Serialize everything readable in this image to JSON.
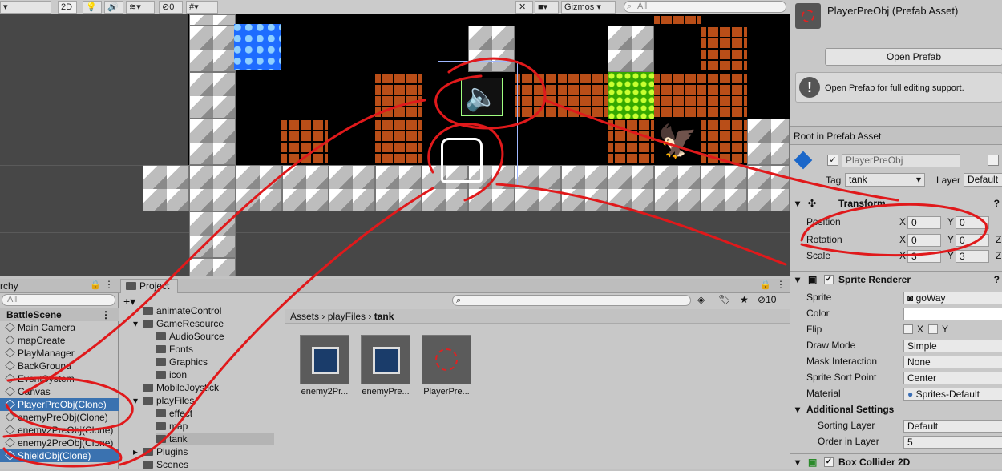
{
  "toolbar": {
    "mode_2d": "2D",
    "hidden_count": "0",
    "gizmos_label": "Gizmos",
    "search_placeholder": "All"
  },
  "hierarchy": {
    "tab": "rchy",
    "search_placeholder": "All",
    "scene": "BattleScene",
    "items": [
      {
        "label": "Main Camera",
        "selected": false
      },
      {
        "label": "mapCreate",
        "selected": false
      },
      {
        "label": "PlayManager",
        "selected": false
      },
      {
        "label": "BackGround",
        "selected": false
      },
      {
        "label": "EventSystem",
        "selected": false
      },
      {
        "label": "Canvas",
        "selected": false
      },
      {
        "label": "PlayerPreObj(Clone)",
        "selected": true
      },
      {
        "label": "enemyPreObj(Clone)",
        "selected": false
      },
      {
        "label": "enemy2PreObj(Clone)",
        "selected": false
      },
      {
        "label": "enemy2PreObj(Clone)",
        "selected": false
      },
      {
        "label": "ShieldObj(Clone)",
        "selected": true
      }
    ]
  },
  "project": {
    "tab": "Project",
    "hidden_count": "10",
    "tree": [
      "animateControl",
      "GameResource",
      "AudioSource",
      "Fonts",
      "Graphics",
      "icon",
      "MobileJoystick",
      "playFiles",
      "effect",
      "map",
      "tank",
      "Plugins",
      "Scenes"
    ],
    "breadcrumb": [
      "Assets",
      "playFiles",
      "tank"
    ],
    "assets": [
      "enemy2Pr...",
      "enemyPre...",
      "PlayerPre..."
    ]
  },
  "inspector": {
    "title": "PlayerPreObj (Prefab Asset)",
    "open_prefab": "Open Prefab",
    "info": "Open Prefab for full editing support.",
    "root_label": "Root in Prefab Asset",
    "object_name": "PlayerPreObj",
    "tag_label": "Tag",
    "tag_value": "tank",
    "layer_label": "Layer",
    "layer_value": "Default",
    "transform": {
      "header": "Transform",
      "position_label": "Position",
      "rotation_label": "Rotation",
      "scale_label": "Scale",
      "pos_x": "0",
      "pos_y": "0",
      "rot_x": "0",
      "rot_y": "0",
      "scale_x": "3",
      "scale_y": "3"
    },
    "sprite_renderer": {
      "header": "Sprite Renderer",
      "sprite_label": "Sprite",
      "sprite_value": "goWay",
      "color_label": "Color",
      "flip_label": "Flip",
      "flip_x": "X",
      "flip_y": "Y",
      "draw_mode_label": "Draw Mode",
      "draw_mode_value": "Simple",
      "mask_label": "Mask Interaction",
      "mask_value": "None",
      "sort_point_label": "Sprite Sort Point",
      "sort_point_value": "Center",
      "material_label": "Material",
      "material_value": "Sprites-Default",
      "additional_label": "Additional Settings",
      "sorting_layer_label": "Sorting Layer",
      "sorting_layer_value": "Default",
      "order_label": "Order in Layer",
      "order_value": "5"
    },
    "box_collider": "Box Collider 2D"
  },
  "colors": {
    "annotation": "#e0191b",
    "selection": "#3a72b0"
  }
}
